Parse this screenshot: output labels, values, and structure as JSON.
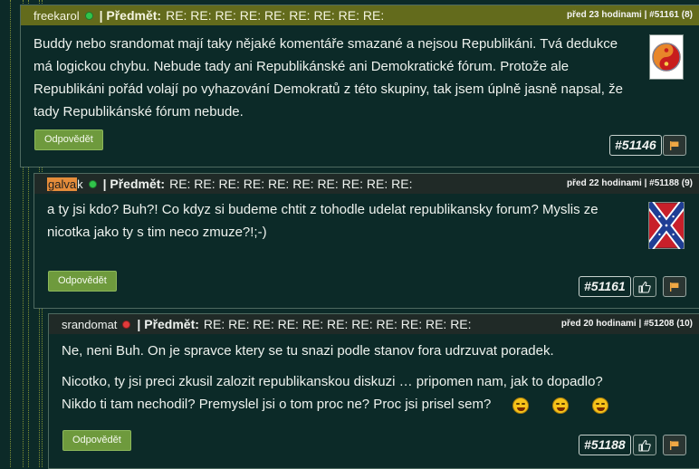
{
  "posts": [
    {
      "author": "freekarol",
      "status": "online",
      "subject_label": "| Předmět:",
      "subject": "RE: RE: RE: RE: RE: RE: RE: RE: RE:",
      "meta": "před 23 hodinami | #51161 (8)",
      "body": [
        "Buddy nebo srandomat mají taky nějaké komentáře smazané a nejsou Republikáni. Tvá dedukce má logickou chybu. Nebude tady ani Republikánské ani Demokratické fórum. Protože ale Republikáni pořád volají po vyhazování Demokratů z této skupiny, tak jsem úplně jasně napsal, že tady Republikánské fórum nebude."
      ],
      "reply_label": "Odpovědět",
      "reply_ref": "#51146",
      "avatar_icon": "yin-yang-icon"
    },
    {
      "author_highlight": "galva",
      "author_rest": "k",
      "status": "online",
      "subject_label": "| Předmět:",
      "subject": "RE: RE: RE: RE: RE: RE: RE: RE: RE: RE:",
      "meta": "před 22 hodinami | #51188 (9)",
      "body": [
        "a ty jsi kdo? Buh?! Co kdyz si budeme chtit z tohodle udelat republikansky forum? Myslis ze nicotka jako ty s tim neco zmuze?!;-)"
      ],
      "reply_label": "Odpovědět",
      "reply_ref": "#51161",
      "avatar_icon": "confederate-flag-icon"
    },
    {
      "author": "srandomat",
      "status": "offline",
      "subject_label": "| Předmět:",
      "subject": "RE: RE: RE: RE: RE: RE: RE: RE: RE: RE: RE:",
      "meta": "před 20 hodinami | #51208 (10)",
      "body": [
        "Ne, neni Buh. On je spravce ktery se tu snazi podle stanov fora udrzuvat poradek.",
        "Nicotko, ty jsi preci zkusil zalozit republikanskou diskuzi … pripomen nam, jak to dopadlo? Nikdo ti tam nechodil? Premyslel jsi o tom proc ne? Proc jsi prisel sem?"
      ],
      "reply_label": "Odpovědět",
      "reply_ref": "#51188"
    }
  ],
  "colors": {
    "background": "#0c2a28",
    "header_olive": "#636b1c",
    "header_dark": "#202a27",
    "reply_button": "#6e9a3d"
  }
}
